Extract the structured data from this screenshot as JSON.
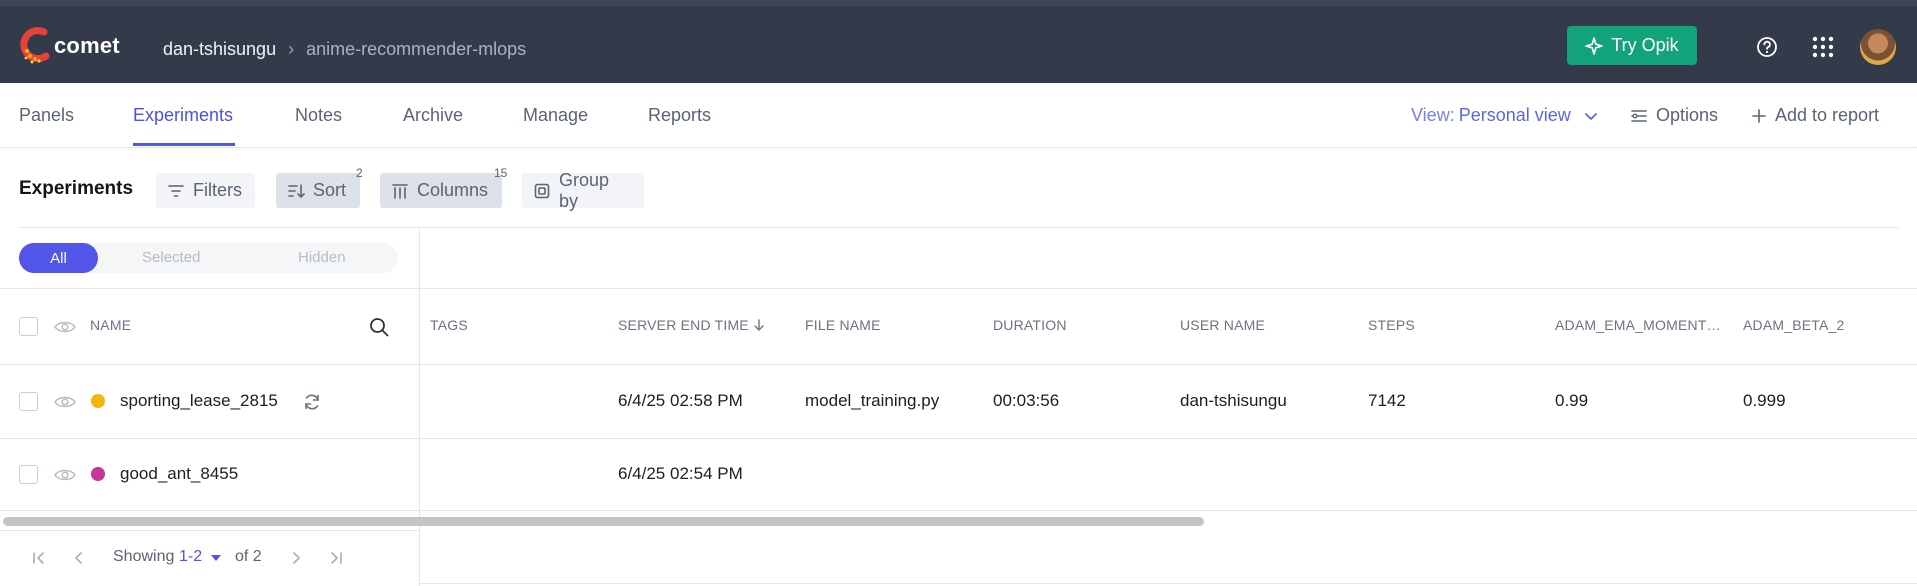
{
  "app": {
    "logo_text": "comet",
    "workspace": "dan-tshisungu",
    "project": "anime-recommender-mlops",
    "try_opik_label": "Try Opik"
  },
  "tabs": [
    {
      "label": "Panels",
      "active": false
    },
    {
      "label": "Experiments",
      "active": true
    },
    {
      "label": "Notes",
      "active": false
    },
    {
      "label": "Archive",
      "active": false
    },
    {
      "label": "Manage",
      "active": false
    },
    {
      "label": "Reports",
      "active": false
    }
  ],
  "view": {
    "prefix": "View:",
    "value": "Personal view"
  },
  "options_label": "Options",
  "add_to_report_label": "Add to report",
  "toolbar": {
    "title": "Experiments",
    "filters_label": "Filters",
    "sort_label": "Sort",
    "sort_count": "2",
    "columns_label": "Columns",
    "columns_count": "15",
    "group_by_label": "Group by"
  },
  "visibility_filter": {
    "all": "All",
    "selected": "Selected",
    "hidden": "Hidden"
  },
  "table": {
    "columns": [
      "NAME",
      "TAGS",
      "SERVER END TIME",
      "FILE NAME",
      "DURATION",
      "USER NAME",
      "STEPS",
      "ADAM_EMA_MOMENT…",
      "ADAM_BETA_2"
    ],
    "rows": [
      {
        "name": "sporting_lease_2815",
        "color": "#f2b40f",
        "tags": "",
        "server_end_time": "6/4/25 02:58 PM",
        "file_name": "model_training.py",
        "duration": "00:03:56",
        "user_name": "dan-tshisungu",
        "steps": "7142",
        "adam_ema_moment": "0.99",
        "adam_beta_2": "0.999"
      },
      {
        "name": "good_ant_8455",
        "color": "#c4369b",
        "tags": "",
        "server_end_time": "6/4/25 02:54 PM",
        "file_name": "",
        "duration": "",
        "user_name": "",
        "steps": "",
        "adam_ema_moment": "",
        "adam_beta_2": ""
      }
    ]
  },
  "pagination": {
    "showing": "Showing",
    "range": "1-2",
    "of": "of 2"
  },
  "colors": {
    "topbar": "#333b4a",
    "accent": "#5155e8",
    "opik_green": "#13a37a"
  }
}
